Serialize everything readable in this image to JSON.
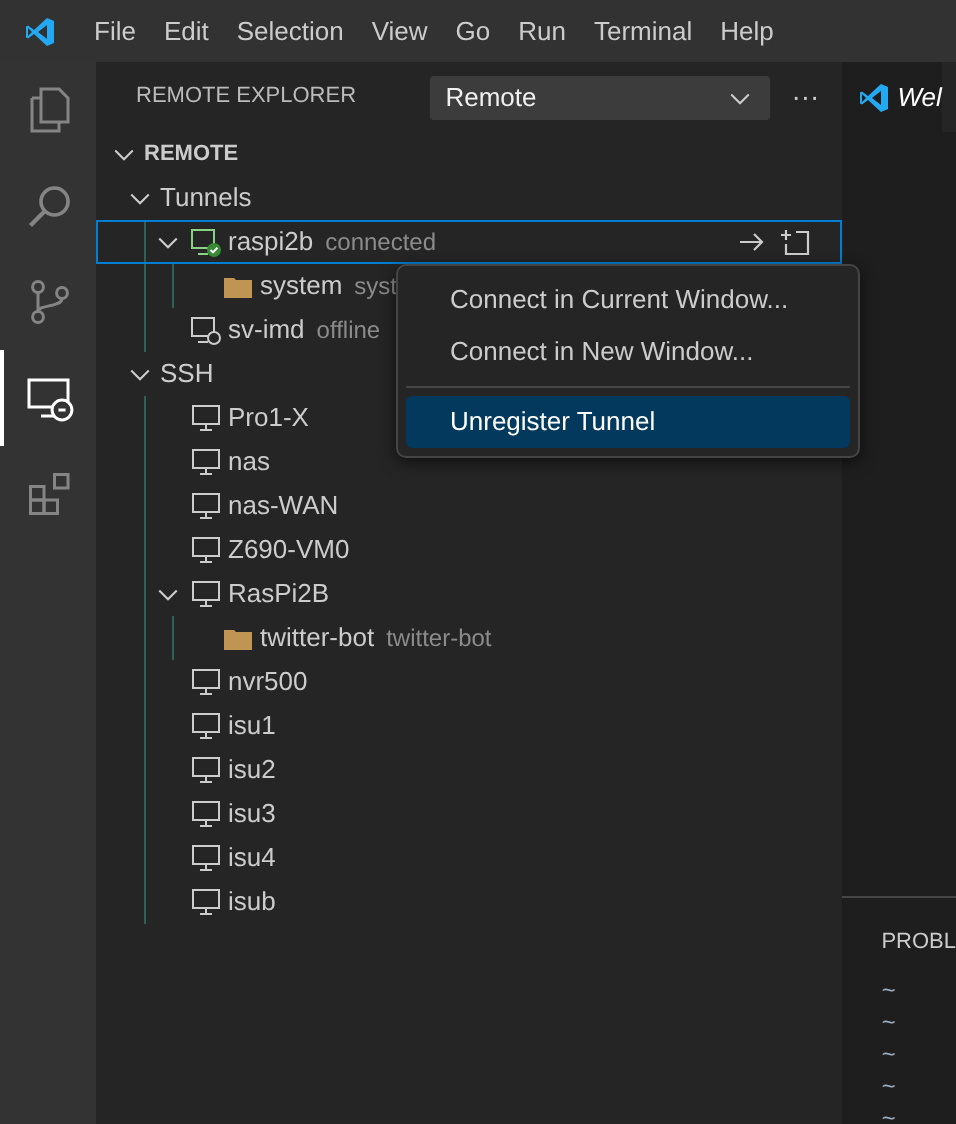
{
  "menubar": {
    "items": [
      "File",
      "Edit",
      "Selection",
      "View",
      "Go",
      "Run",
      "Terminal",
      "Help"
    ]
  },
  "activity_bar": [
    {
      "kind": "explorer",
      "selected": false
    },
    {
      "kind": "search",
      "selected": false
    },
    {
      "kind": "source-control",
      "selected": false
    },
    {
      "kind": "remote",
      "selected": true
    },
    {
      "kind": "extensions",
      "selected": false
    }
  ],
  "sidebar": {
    "title": "REMOTE EXPLORER",
    "dropdown": "Remote",
    "more": "···",
    "tree": [
      {
        "label": "REMOTE",
        "kind": "section",
        "expanded": true,
        "selected": false,
        "children": [
          {
            "label": "Tunnels",
            "kind": "group",
            "expanded": true,
            "selected": false,
            "children": [
              {
                "label": "raspi2b",
                "description": "connected",
                "kind": "tunnel-connected",
                "expanded": true,
                "selected": true,
                "children": [
                  {
                    "label": "system",
                    "description": "syst",
                    "kind": "folder",
                    "selected": false
                  }
                ]
              },
              {
                "label": "sv-imd",
                "description": "offline",
                "kind": "tunnel-offline",
                "selected": false
              }
            ]
          },
          {
            "label": "SSH",
            "kind": "group",
            "expanded": true,
            "selected": false,
            "children": [
              {
                "label": "Pro1-X",
                "kind": "host",
                "selected": false
              },
              {
                "label": "nas",
                "kind": "host",
                "selected": false
              },
              {
                "label": "nas-WAN",
                "kind": "host",
                "selected": false
              },
              {
                "label": "Z690-VM0",
                "kind": "host",
                "selected": false
              },
              {
                "label": "RasPi2B",
                "kind": "host",
                "expanded": true,
                "selected": false,
                "children": [
                  {
                    "label": "twitter-bot",
                    "description": "twitter-bot",
                    "kind": "folder",
                    "selected": false
                  }
                ]
              },
              {
                "label": "nvr500",
                "kind": "host",
                "selected": false
              },
              {
                "label": "isu1",
                "kind": "host",
                "selected": false
              },
              {
                "label": "isu2",
                "kind": "host",
                "selected": false
              },
              {
                "label": "isu3",
                "kind": "host",
                "selected": false
              },
              {
                "label": "isu4",
                "kind": "host",
                "selected": false
              },
              {
                "label": "isub",
                "kind": "host",
                "selected": false
              }
            ]
          }
        ]
      }
    ]
  },
  "context_menu": {
    "groups": [
      [
        {
          "label": "Connect in Current Window...",
          "selected": false
        },
        {
          "label": "Connect in New Window...",
          "selected": false
        }
      ],
      [
        {
          "label": "Unregister Tunnel",
          "selected": true
        }
      ]
    ]
  },
  "editor": {
    "tab": "Wel"
  },
  "panel": {
    "title": "PROBL",
    "lines": [
      "~",
      "~",
      "~",
      "~",
      "~"
    ]
  }
}
